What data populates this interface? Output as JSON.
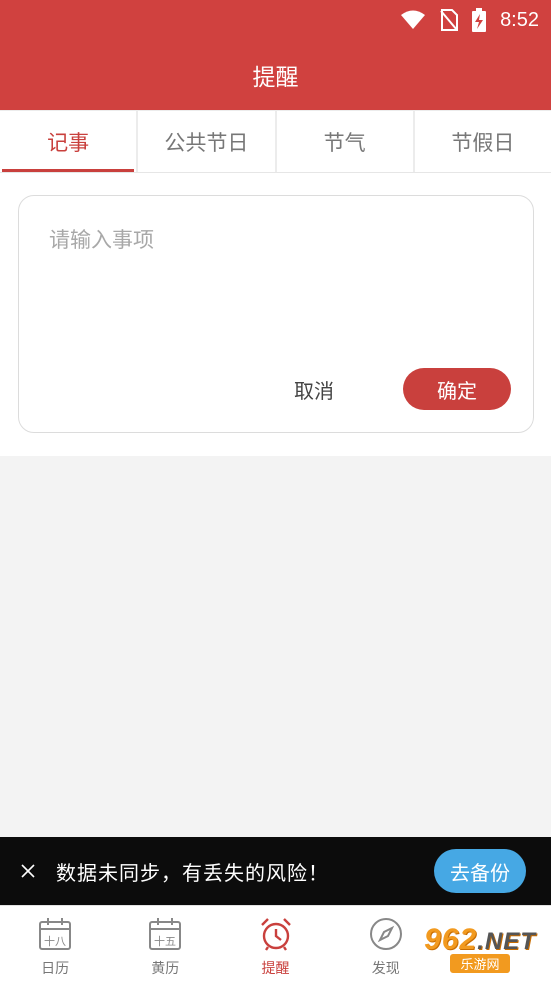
{
  "status_bar": {
    "time": "8:52",
    "icons": [
      "wifi-icon",
      "no-sim-icon",
      "battery-charging-icon"
    ]
  },
  "header": {
    "title": "提醒"
  },
  "tabs": [
    {
      "label": "记事",
      "active": true
    },
    {
      "label": "公共节日",
      "active": false
    },
    {
      "label": "节气",
      "active": false
    },
    {
      "label": "节假日",
      "active": false
    }
  ],
  "note_form": {
    "input_value": "",
    "input_placeholder": "请输入事项",
    "cancel_label": "取消",
    "confirm_label": "确定"
  },
  "sync_banner": {
    "message": "数据未同步，有丢失的风险！",
    "backup_label": "去备份",
    "close_icon": "close-icon"
  },
  "bottom_nav": [
    {
      "label": "日历",
      "icon": "calendar-icon",
      "icon_text": "十八",
      "active": false
    },
    {
      "label": "黄历",
      "icon": "almanac-icon",
      "icon_text": "十五",
      "active": false
    },
    {
      "label": "提醒",
      "icon": "alarm-clock-icon",
      "active": true
    },
    {
      "label": "发现",
      "icon": "compass-icon",
      "active": false
    },
    {
      "label": "",
      "icon": "profile-icon",
      "active": false
    }
  ],
  "watermark": {
    "main": "962",
    "suffix": ".NET",
    "sub": "乐游网"
  },
  "colors": {
    "brand_red": "#d0413f",
    "accent_red": "#c9403d",
    "backup_blue": "#46a8e4",
    "banner_black": "#0c0c0c"
  }
}
